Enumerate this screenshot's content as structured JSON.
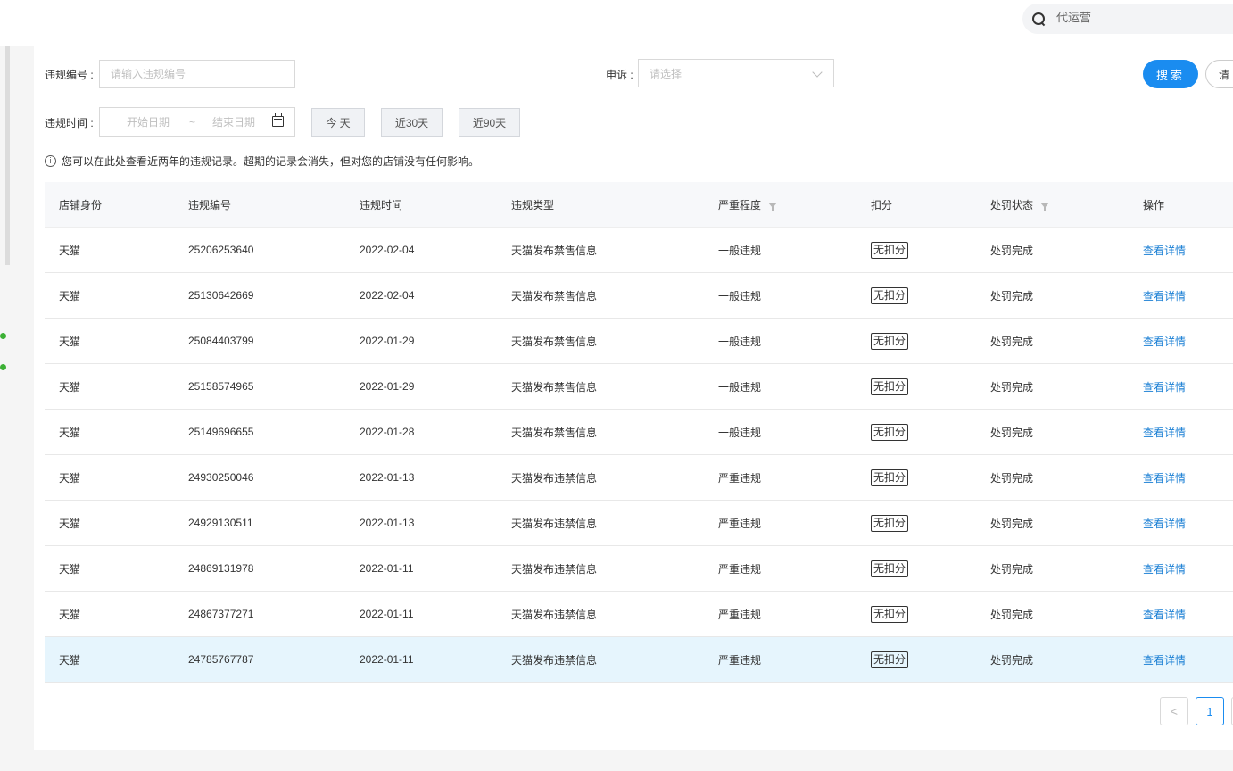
{
  "header": {
    "search_placeholder": "代运营"
  },
  "filters": {
    "violation_no_label": "违规编号 :",
    "violation_no_placeholder": "请输入违规编号",
    "appeal_label": "申诉 :",
    "appeal_placeholder": "请选择",
    "time_label": "违规时间 :",
    "start_date": "开始日期",
    "range_sep": "~",
    "end_date": "结束日期",
    "today": "今 天",
    "last30": "近30天",
    "last90": "近90天",
    "search": "搜索",
    "clear": "清"
  },
  "notice": "您可以在此处查看近两年的违规记录。超期的记录会消失，但对您的店铺没有任何影响。",
  "table": {
    "columns": [
      "店铺身份",
      "违规编号",
      "违规时间",
      "违规类型",
      "严重程度",
      "扣分",
      "处罚状态",
      "操作"
    ],
    "rows": [
      [
        "天猫",
        "25206253640",
        "2022-02-04",
        "天猫发布禁售信息",
        "一般违规",
        "无扣分",
        "处罚完成",
        "查看详情"
      ],
      [
        "天猫",
        "25130642669",
        "2022-02-04",
        "天猫发布禁售信息",
        "一般违规",
        "无扣分",
        "处罚完成",
        "查看详情"
      ],
      [
        "天猫",
        "25084403799",
        "2022-01-29",
        "天猫发布禁售信息",
        "一般违规",
        "无扣分",
        "处罚完成",
        "查看详情"
      ],
      [
        "天猫",
        "25158574965",
        "2022-01-29",
        "天猫发布禁售信息",
        "一般违规",
        "无扣分",
        "处罚完成",
        "查看详情"
      ],
      [
        "天猫",
        "25149696655",
        "2022-01-28",
        "天猫发布禁售信息",
        "一般违规",
        "无扣分",
        "处罚完成",
        "查看详情"
      ],
      [
        "天猫",
        "24930250046",
        "2022-01-13",
        "天猫发布违禁信息",
        "严重违规",
        "无扣分",
        "处罚完成",
        "查看详情"
      ],
      [
        "天猫",
        "24929130511",
        "2022-01-13",
        "天猫发布违禁信息",
        "严重违规",
        "无扣分",
        "处罚完成",
        "查看详情"
      ],
      [
        "天猫",
        "24869131978",
        "2022-01-11",
        "天猫发布违禁信息",
        "严重违规",
        "无扣分",
        "处罚完成",
        "查看详情"
      ],
      [
        "天猫",
        "24867377271",
        "2022-01-11",
        "天猫发布违禁信息",
        "严重违规",
        "无扣分",
        "处罚完成",
        "查看详情"
      ],
      [
        "天猫",
        "24785767787",
        "2022-01-11",
        "天猫发布违禁信息",
        "严重违规",
        "无扣分",
        "处罚完成",
        "查看详情"
      ]
    ]
  },
  "pagination": {
    "prev": "<",
    "current": "1"
  },
  "colors": {
    "primary": "#1a8cf0",
    "link": "#1a7fd4",
    "highlight_row": "#e6f5fd"
  }
}
